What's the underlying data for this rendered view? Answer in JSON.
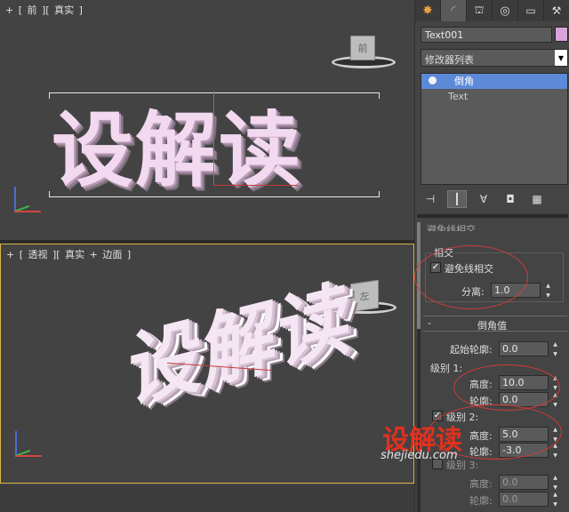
{
  "viewports": {
    "front": {
      "label_plus": "+",
      "label_bracket": "[",
      "view_name": "前",
      "shading": "真实",
      "label_close": "]",
      "text_object": "设解读",
      "viewcube_face": "前"
    },
    "perspective": {
      "label_plus": "+",
      "label_bracket": "[",
      "view_name": "透视",
      "shading": "真实",
      "edge_plus": "+",
      "edge_mode": "边面",
      "label_close": "]",
      "text_object": "设解读",
      "viewcube_face": "左"
    }
  },
  "panel": {
    "object_name": "Text001",
    "object_color": "#d9a4dc",
    "modifier_list_label": "修改器列表",
    "stack": [
      {
        "label": "倒角",
        "selected": true
      },
      {
        "label": "Text",
        "selected": false
      }
    ],
    "intersection_group": {
      "title": "相交",
      "avoid_label": "避免线相交",
      "avoid_checked": true,
      "separation_label": "分离:",
      "separation_value": "1.0"
    },
    "bevel_values": {
      "collapse": "-",
      "title": "倒角值",
      "start_outline_label": "起始轮廓:",
      "start_outline_value": "0.0",
      "level1": {
        "label": "级别 1:",
        "height_label": "高度:",
        "height_value": "10.0",
        "outline_label": "轮廓:",
        "outline_value": "0.0"
      },
      "level2": {
        "label": "级别 2:",
        "checked": true,
        "height_label": "高度:",
        "height_value": "5.0",
        "outline_label": "轮廓:",
        "outline_value": "-3.0"
      },
      "level3": {
        "label": "级别 3:",
        "checked": false,
        "height_label": "高度:",
        "height_value": "0.0",
        "outline_label": "轮廓:",
        "outline_value": "0.0"
      }
    },
    "truncated_label": "避免线相交"
  },
  "watermark": {
    "logo": "设解读",
    "url": "shejiedu.com"
  },
  "colors": {
    "accent": "#5d8ad8",
    "annotation": "#d23a3a",
    "viewport_bg": "#434343",
    "active_border": "#d9b54a"
  }
}
